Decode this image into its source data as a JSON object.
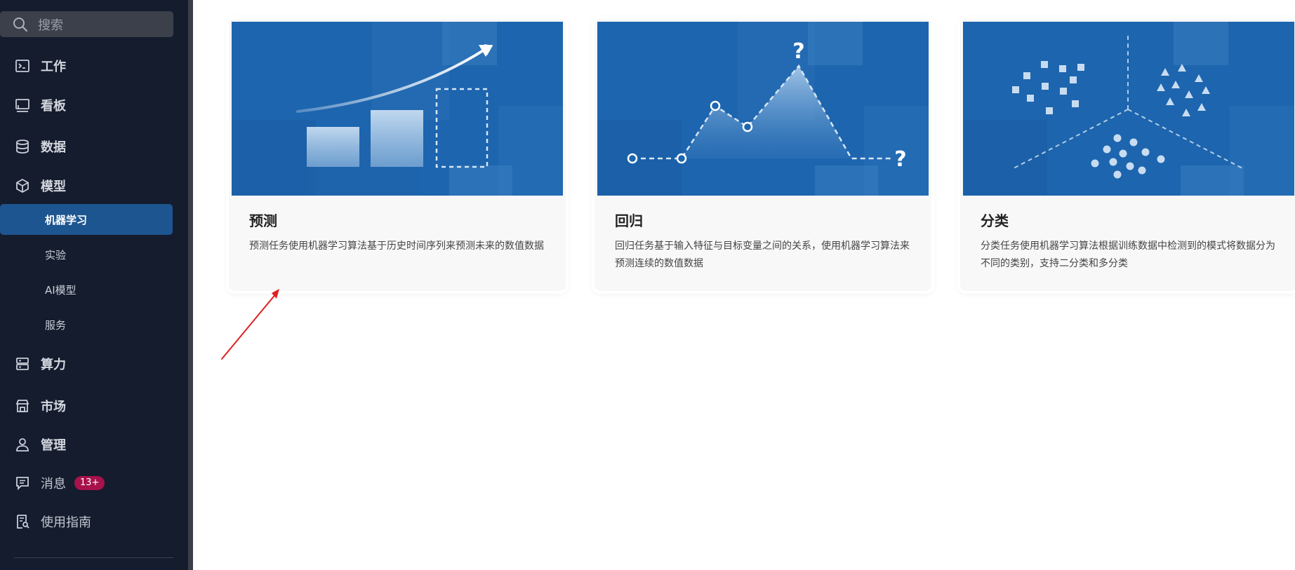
{
  "sidebar": {
    "search_placeholder": "搜索",
    "items": [
      {
        "label": "工作",
        "icon": "terminal-icon"
      },
      {
        "label": "看板",
        "icon": "monitor-icon"
      },
      {
        "label": "数据",
        "icon": "database-icon"
      },
      {
        "label": "模型",
        "icon": "cube-icon"
      }
    ],
    "sub_items": [
      {
        "label": "机器学习",
        "active": true
      },
      {
        "label": "实验",
        "active": false
      },
      {
        "label": "AI模型",
        "active": false
      },
      {
        "label": "服务",
        "active": false
      }
    ],
    "items_after": [
      {
        "label": "算力",
        "icon": "server-icon"
      },
      {
        "label": "市场",
        "icon": "store-icon"
      },
      {
        "label": "管理",
        "icon": "user-icon"
      }
    ],
    "messages": {
      "label": "消息",
      "badge": "13+",
      "icon": "message-icon"
    },
    "guide": {
      "label": "使用指南",
      "icon": "guide-icon"
    }
  },
  "cards": [
    {
      "title": "预测",
      "description": "预测任务使用机器学习算法基于历史时间序列来预测未来的数值数据",
      "illustration": "bar-trend-chart"
    },
    {
      "title": "回归",
      "description": "回归任务基于输入特征与目标变量之间的关系，使用机器学习算法来预测连续的数值数据",
      "illustration": "line-peaks-question"
    },
    {
      "title": "分类",
      "description": "分类任务使用机器学习算法根据训练数据中检测到的模式将数据分为不同的类别，支持二分类和多分类",
      "illustration": "cluster-scatter"
    }
  ],
  "colors": {
    "sidebar_bg": "#141c2e",
    "active_item": "#1d5590",
    "badge": "#a8124a",
    "card_image_bg": "#1d65ae",
    "annotation_arrow": "#e02020"
  }
}
